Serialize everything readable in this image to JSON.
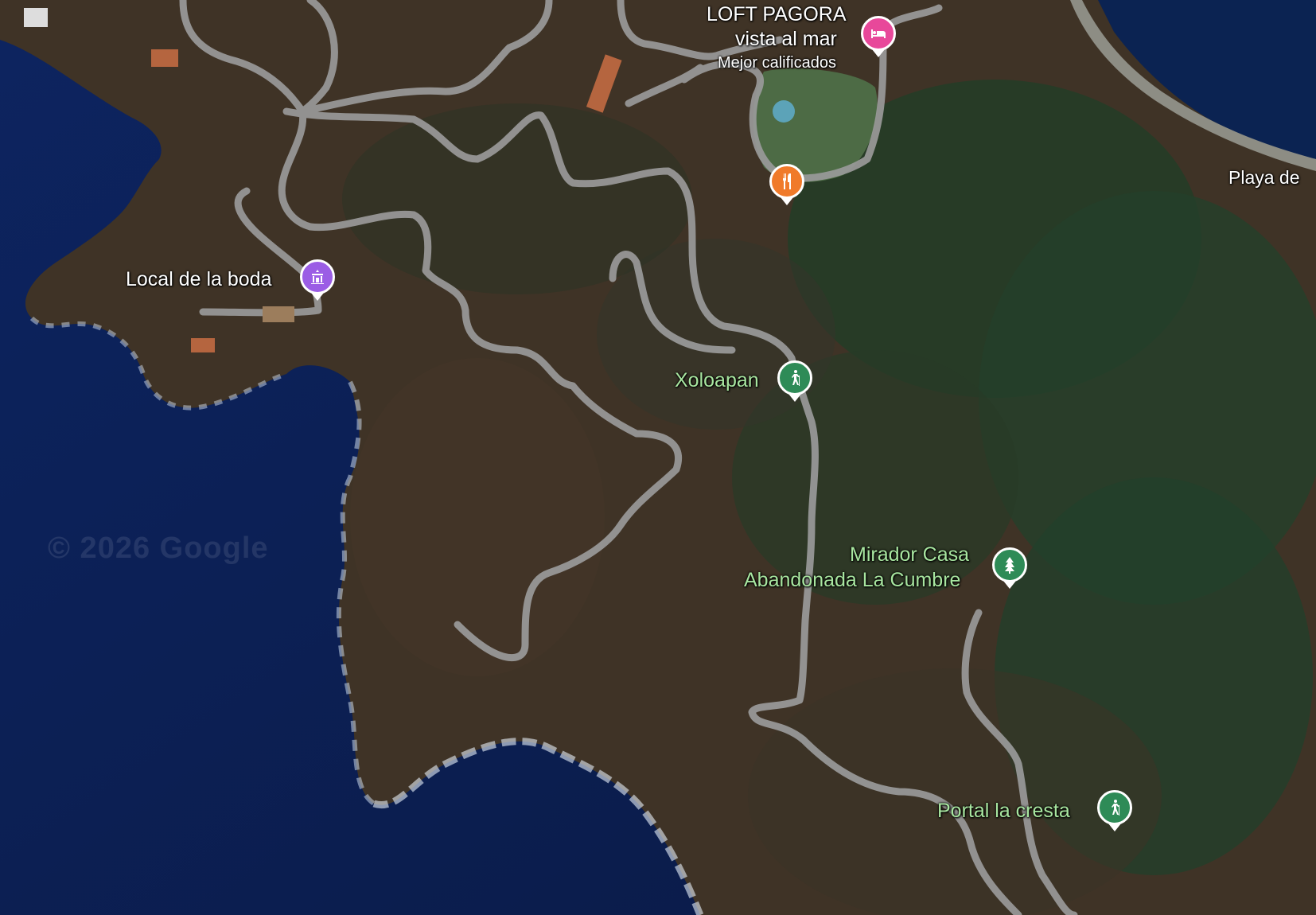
{
  "map": {
    "view": "satellite",
    "watermark": "© 2026 Google",
    "colors": {
      "ocean": "#0b1d4d",
      "terrain": "#3f3326",
      "forest": "#1f3a22",
      "road": "#9a9a9a",
      "lodging_pin": "#e8489a",
      "restaurant_pin": "#f07a2a",
      "venue_pin": "#9b5de5",
      "outdoor_pin": "#2e8b57"
    }
  },
  "places": {
    "loft": {
      "name_line1": "LOFT PAGORA",
      "name_line2": "vista al mar",
      "badge": "Mejor calificados",
      "icon": "bed-icon"
    },
    "restaurant": {
      "icon": "fork-knife-icon"
    },
    "wedding": {
      "name": "Local de la boda",
      "icon": "venue-icon"
    },
    "xoloapan": {
      "name": "Xoloapan",
      "icon": "hiker-icon"
    },
    "mirador": {
      "name_line1": "Mirador Casa",
      "name_line2": "Abandonada La Cumbre",
      "icon": "tree-icon"
    },
    "portal": {
      "name": "Portal la cresta",
      "icon": "hiker-icon"
    },
    "beach": {
      "name": "Playa de"
    }
  }
}
